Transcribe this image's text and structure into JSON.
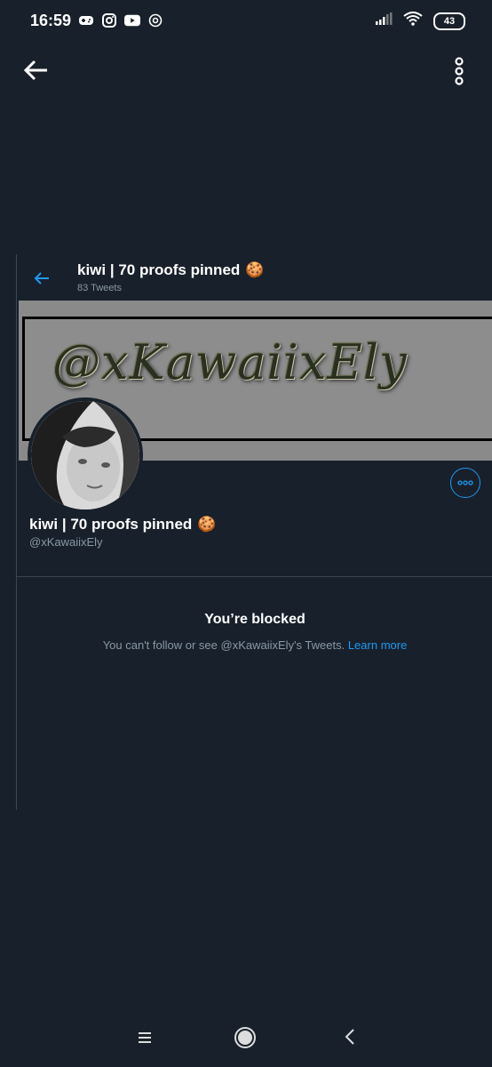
{
  "status_bar": {
    "time": "16:59",
    "battery": "43",
    "icons": [
      "game-controller-icon",
      "instagram-icon",
      "youtube-icon",
      "at-sign-icon"
    ]
  },
  "embed": {
    "title": "kiwi | 70 proofs pinned",
    "tweet_count": "83 Tweets",
    "banner_text": "@xKawaiixEly",
    "emoji": "🍪"
  },
  "profile": {
    "name": "kiwi | 70 proofs pinned",
    "handle": "@xKawaiixEly"
  },
  "blocked": {
    "title": "You’re blocked",
    "message": "You can't follow or see @xKawaiixEly's Tweets.",
    "learn_more": "Learn more"
  },
  "colors": {
    "background": "#18202b",
    "accent": "#1d9bf0",
    "muted_text": "#8899a6"
  }
}
